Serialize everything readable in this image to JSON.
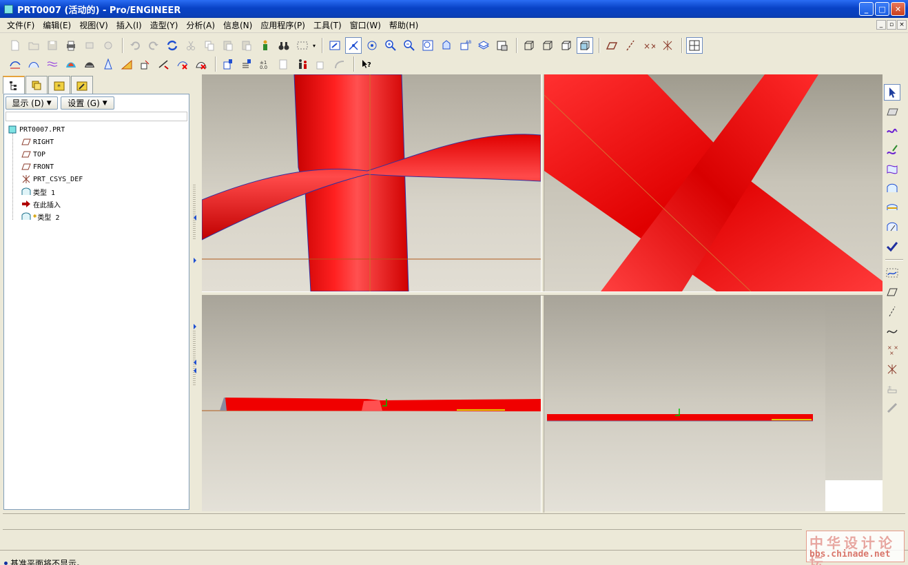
{
  "window": {
    "title": "PRT0007 (活动的) - Pro/ENGINEER",
    "buttons": [
      "minimize",
      "maximize",
      "close"
    ]
  },
  "menubar": {
    "items": [
      {
        "label": "文件(F)"
      },
      {
        "label": "编辑(E)"
      },
      {
        "label": "视图(V)"
      },
      {
        "label": "插入(I)"
      },
      {
        "label": "造型(Y)"
      },
      {
        "label": "分析(A)"
      },
      {
        "label": "信息(N)"
      },
      {
        "label": "应用程序(P)"
      },
      {
        "label": "工具(T)"
      },
      {
        "label": "窗口(W)"
      },
      {
        "label": "帮助(H)"
      }
    ]
  },
  "left_panel": {
    "tabs": [
      "model-tree-tab",
      "layers-tab",
      "favorites-tab",
      "tools-tab"
    ],
    "show_button": "显示 (D)",
    "settings_button": "设置 (G)",
    "tree": [
      {
        "label": "PRT0007.PRT",
        "icon": "part-icon"
      },
      {
        "label": "RIGHT",
        "icon": "datum-plane-icon"
      },
      {
        "label": "TOP",
        "icon": "datum-plane-icon"
      },
      {
        "label": "FRONT",
        "icon": "datum-plane-icon"
      },
      {
        "label": "PRT_CSYS_DEF",
        "icon": "csys-icon"
      },
      {
        "label": "类型 1",
        "icon": "style-feature-icon"
      },
      {
        "label": "在此插入",
        "icon": "insert-here-arrow-icon"
      },
      {
        "label": "类型 2",
        "icon": "style-feature-icon"
      }
    ]
  },
  "status": {
    "message": "基准平面将不显示。"
  },
  "watermark": {
    "line1": "中华设计论坛",
    "line2": "bbs.chinade.net"
  },
  "colors": {
    "model": "#f40000",
    "titlebar": "#0a3fb8",
    "background": "#ece9d8"
  }
}
